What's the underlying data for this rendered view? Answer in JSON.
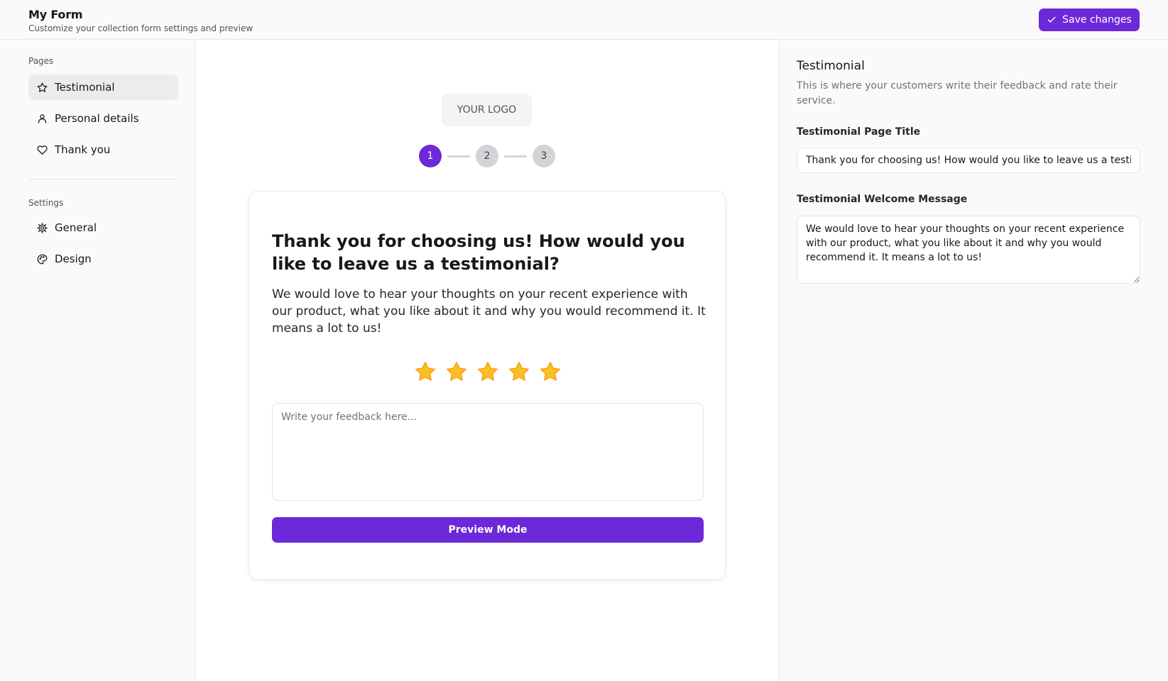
{
  "header": {
    "title": "My Form",
    "subtitle": "Customize your collection form settings and preview",
    "save_label": "Save changes",
    "save_icon": "check-icon"
  },
  "sidebar": {
    "pages_label": "Pages",
    "pages": [
      {
        "label": "Testimonial",
        "icon": "star-icon",
        "active": true
      },
      {
        "label": "Personal details",
        "icon": "user-icon",
        "active": false
      },
      {
        "label": "Thank you",
        "icon": "heart-icon",
        "active": false
      }
    ],
    "settings_label": "Settings",
    "settings": [
      {
        "label": "General",
        "icon": "gear-icon"
      },
      {
        "label": "Design",
        "icon": "palette-icon"
      }
    ]
  },
  "preview": {
    "logo_text": "YOUR LOGO",
    "steps": [
      "1",
      "2",
      "3"
    ],
    "current_step": 1,
    "title": "Thank you for choosing us! How would you like to leave us a testimonial?",
    "message": "We would love to hear your thoughts on your recent experience with our product, what you like about it and why you would recommend it. It means a lot to us!",
    "rating": 5,
    "rating_max": 5,
    "feedback_placeholder": "Write your feedback here...",
    "feedback_value": "",
    "button_label": "Preview Mode"
  },
  "panel": {
    "title": "Testimonial",
    "description": "This is where your customers write their feedback and rate their service.",
    "page_title_label": "Testimonial Page Title",
    "page_title_value": "Thank you for choosing us! How would you like to leave us a testimonial?",
    "welcome_label": "Testimonial Welcome Message",
    "welcome_value": "We would love to hear your thoughts on your recent experience with our product, what you like about it and why you would recommend it. It means a lot to us!"
  },
  "colors": {
    "accent": "#6d28d9",
    "star": "#fbbf24",
    "step_inactive": "#d4d4d8"
  }
}
